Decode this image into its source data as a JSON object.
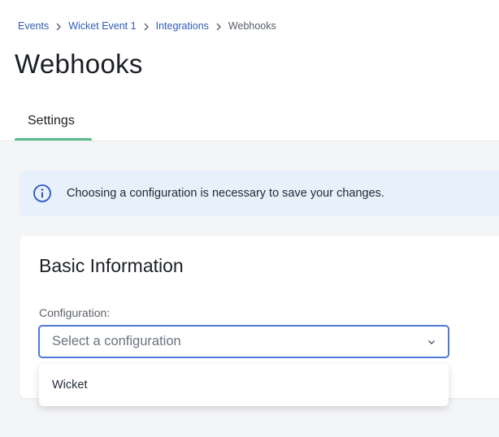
{
  "breadcrumb": {
    "items": [
      {
        "label": "Events"
      },
      {
        "label": "Wicket Event 1"
      },
      {
        "label": "Integrations"
      },
      {
        "label": "Webhooks"
      }
    ]
  },
  "page": {
    "title": "Webhooks"
  },
  "tabs": [
    {
      "label": "Settings",
      "active": true
    }
  ],
  "notice": {
    "text": "Choosing a configuration is necessary to save your changes.",
    "icon": "info-icon"
  },
  "card": {
    "title": "Basic Information",
    "configuration": {
      "label": "Configuration:",
      "placeholder": "Select a configuration",
      "options": [
        "Wicket"
      ]
    }
  },
  "colors": {
    "link": "#2f5bb7",
    "tab_accent": "#5cba8a",
    "focus_border": "#4e7ad6",
    "notice_bg": "#e8f0fb",
    "info_icon": "#2a55c4"
  }
}
